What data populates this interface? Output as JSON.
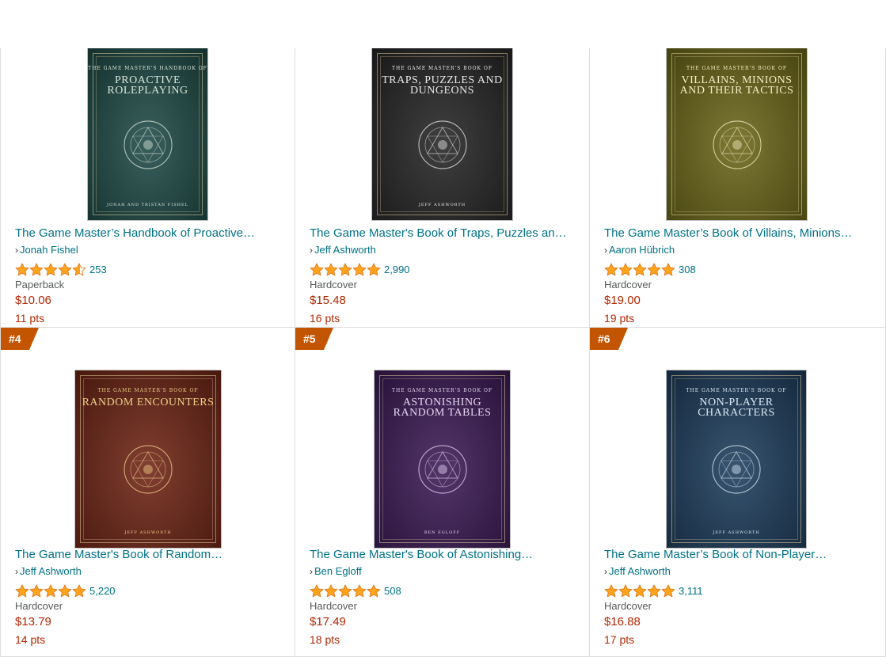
{
  "items": [
    {
      "rank": "",
      "title": "The Game Master’s Handbook of Proactive…",
      "author": "Jonah Fishel",
      "stars": 4.5,
      "rating_count": "253",
      "format": "Paperback",
      "price": "$10.06",
      "points": "11 pts",
      "cover": {
        "bg": "#1e4a46",
        "ink": "#d9e6d8",
        "pre": "THE GAME MASTER'S HANDBOOK OF",
        "title": "PROACTIVE ROLEPLAYING",
        "author": "JONAH AND TRISTAN FISHEL"
      }
    },
    {
      "rank": "",
      "title": "The Game Master's Book of Traps, Puzzles an…",
      "author": "Jeff Ashworth",
      "stars": 5,
      "rating_count": "2,990",
      "format": "Hardcover",
      "price": "$15.48",
      "points": "16 pts",
      "cover": {
        "bg": "#252525",
        "ink": "#e8e8e8",
        "pre": "THE GAME MASTER'S BOOK OF",
        "title": "TRAPS, PUZZLES AND DUNGEONS",
        "author": "JEFF ASHWORTH"
      }
    },
    {
      "rank": "",
      "title": "The Game Master’s Book of Villains, Minions…",
      "author": "Aaron Hübrich",
      "stars": 5,
      "rating_count": "308",
      "format": "Hardcover",
      "price": "$19.00",
      "points": "19 pts",
      "cover": {
        "bg": "#6b6618",
        "ink": "#f5ecc0",
        "pre": "THE GAME MASTER'S BOOK OF",
        "title": "VILLAINS, MINIONS AND THEIR TACTICS",
        "author": ""
      }
    },
    {
      "rank": "#4",
      "title": "The Game Master's Book of Random…",
      "author": "Jeff Ashworth",
      "stars": 5,
      "rating_count": "5,220",
      "format": "Hardcover",
      "price": "$13.79",
      "points": "14 pts",
      "cover": {
        "bg": "#6e2414",
        "ink": "#f0cf8a",
        "pre": "THE GAME MASTER'S BOOK OF",
        "title": "RANDOM ENCOUNTERS",
        "author": "JEFF ASHWORTH"
      }
    },
    {
      "rank": "#5",
      "title": "The Game Master's Book of Astonishing…",
      "author": "Ben Egloff",
      "stars": 5,
      "rating_count": "508",
      "format": "Hardcover",
      "price": "$17.49",
      "points": "18 pts",
      "cover": {
        "bg": "#3b1a55",
        "ink": "#e6d6f2",
        "pre": "THE GAME MASTER'S BOOK OF",
        "title": "ASTONISHING RANDOM TABLES",
        "author": "BEN EGLOFF"
      }
    },
    {
      "rank": "#6",
      "title": "The Game Master’s Book of Non-Player…",
      "author": "Jeff Ashworth",
      "stars": 5,
      "rating_count": "3,111",
      "format": "Hardcover",
      "price": "$16.88",
      "points": "17 pts",
      "cover": {
        "bg": "#1d3d5c",
        "ink": "#dbe9f5",
        "pre": "THE GAME MASTER'S BOOK OF",
        "title": "NON-PLAYER CHARACTERS",
        "author": "JEFF ASHWORTH"
      }
    }
  ],
  "colors": {
    "link": "#007185",
    "price": "#b12704",
    "rank_badge": "#c45500",
    "star": "#ffa41c"
  },
  "icons": {
    "author_prefix": "chevron-right-icon",
    "rating": "star-icon"
  }
}
